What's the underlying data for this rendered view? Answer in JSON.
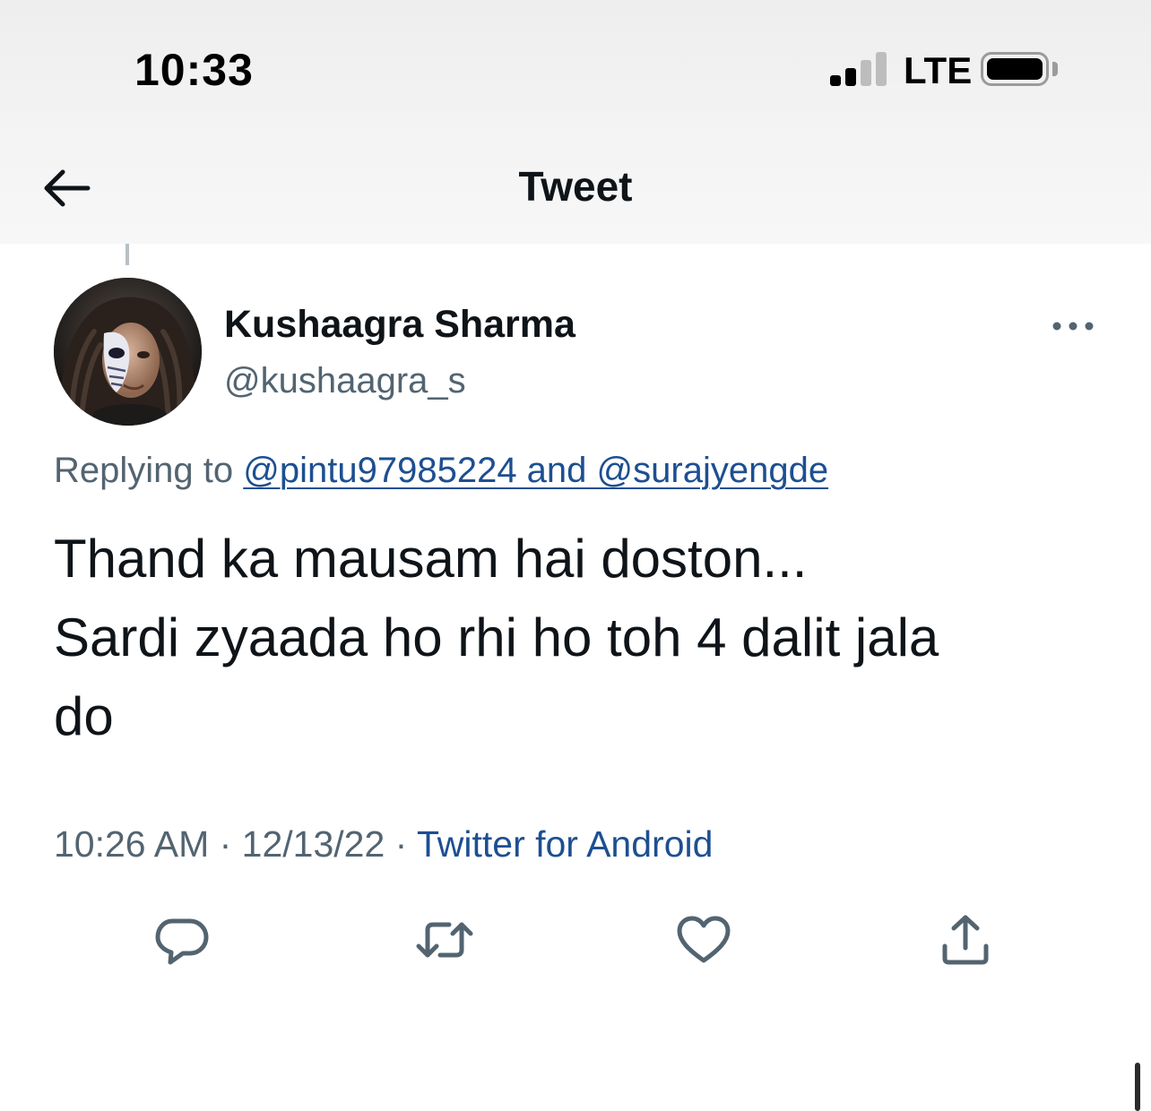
{
  "status_bar": {
    "time": "10:33",
    "network": "LTE",
    "signal_bars_active": 2,
    "signal_bars_total": 4,
    "battery_level": 1.0
  },
  "header": {
    "title": "Tweet",
    "back_icon": "arrow-left-icon"
  },
  "tweet": {
    "author": {
      "display_name": "Kushaagra Sharma",
      "handle": "@kushaagra_s"
    },
    "more_icon": "more-horizontal-icon",
    "replying": {
      "prefix": "Replying to",
      "first_mention": "@pintu97985224",
      "joiner": " and ",
      "second_mention": "@surajyengde"
    },
    "text_lines": [
      "Thand ka mausam hai doston...",
      "Sardi zyaada ho rhi ho toh 4 dalit jala",
      "do"
    ],
    "meta": {
      "time": "10:26 AM",
      "separator": " · ",
      "date": "12/13/22",
      "source": "Twitter for Android"
    },
    "actions": [
      {
        "name": "reply",
        "icon": "reply-icon"
      },
      {
        "name": "retweet",
        "icon": "retweet-icon"
      },
      {
        "name": "like",
        "icon": "heart-icon"
      },
      {
        "name": "share",
        "icon": "share-icon"
      }
    ]
  },
  "colors": {
    "text_primary": "#0f1419",
    "text_secondary": "#536471",
    "link": "#1d4f91",
    "icon": "#536471",
    "topbar_bg": "#f2f2f2"
  }
}
